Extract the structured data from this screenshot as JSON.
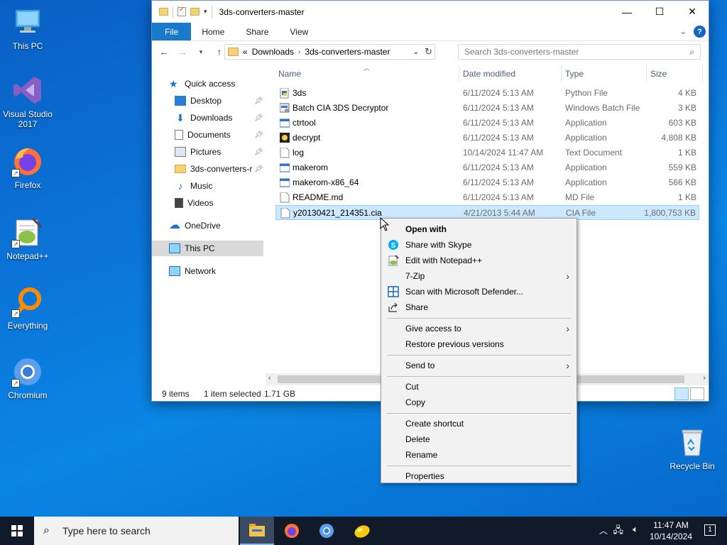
{
  "desktop": {
    "icons": [
      {
        "label": "This PC"
      },
      {
        "label": "Visual Studio 2017"
      },
      {
        "label": "Firefox"
      },
      {
        "label": "Notepad++"
      },
      {
        "label": "Everything"
      },
      {
        "label": "Chromium"
      },
      {
        "label": "Recycle Bin"
      }
    ]
  },
  "window": {
    "title": "3ds-converters-master",
    "tabs": [
      "File",
      "Home",
      "Share",
      "View"
    ],
    "address": {
      "prefix": "«",
      "crumbs": [
        "Downloads",
        "3ds-converters-master"
      ]
    },
    "search_placeholder": "Search 3ds-converters-master",
    "nav_pane": [
      {
        "label": "Quick access"
      },
      {
        "label": "Desktop"
      },
      {
        "label": "Downloads"
      },
      {
        "label": "Documents"
      },
      {
        "label": "Pictures"
      },
      {
        "label": "3ds-converters-r"
      },
      {
        "label": "Music"
      },
      {
        "label": "Videos"
      },
      {
        "label": "OneDrive"
      },
      {
        "label": "This PC"
      },
      {
        "label": "Network"
      }
    ],
    "columns": [
      "Name",
      "Date modified",
      "Type",
      "Size"
    ],
    "files": [
      {
        "name": "3ds",
        "date": "6/11/2024 5:13 AM",
        "type": "Python File",
        "size": "4 KB",
        "icon": "python-file-icon"
      },
      {
        "name": "Batch CIA 3DS Decryptor",
        "date": "6/11/2024 5:13 AM",
        "type": "Windows Batch File",
        "size": "3 KB",
        "icon": "batch-file-icon"
      },
      {
        "name": "ctrtool",
        "date": "6/11/2024 5:13 AM",
        "type": "Application",
        "size": "603 KB",
        "icon": "application-icon"
      },
      {
        "name": "decrypt",
        "date": "6/11/2024 5:13 AM",
        "type": "Application",
        "size": "4,808 KB",
        "icon": "decrypt-app-icon"
      },
      {
        "name": "log",
        "date": "10/14/2024 11:47 AM",
        "type": "Text Document",
        "size": "1 KB",
        "icon": "text-file-icon"
      },
      {
        "name": "makerom",
        "date": "6/11/2024 5:13 AM",
        "type": "Application",
        "size": "559 KB",
        "icon": "application-icon"
      },
      {
        "name": "makerom-x86_64",
        "date": "6/11/2024 5:13 AM",
        "type": "Application",
        "size": "566 KB",
        "icon": "application-icon"
      },
      {
        "name": "README.md",
        "date": "6/11/2024 5:13 AM",
        "type": "MD File",
        "size": "1 KB",
        "icon": "text-file-icon"
      },
      {
        "name": "y20130421_214351.cia",
        "date": "4/21/2013 5:44 AM",
        "type": "CIA File",
        "size": "1,800,753 KB",
        "icon": "blank-file-icon",
        "selected": true
      }
    ],
    "status": {
      "items": "9 items",
      "selected": "1 item selected",
      "size": "1.71 GB"
    }
  },
  "context_menu": {
    "groups": [
      [
        {
          "label": "Open with",
          "bold": true
        },
        {
          "label": "Share with Skype",
          "icon": "skype-icon"
        },
        {
          "label": "Edit with Notepad++",
          "icon": "notepadpp-icon"
        },
        {
          "label": "7-Zip",
          "submenu": true
        },
        {
          "label": "Scan with Microsoft Defender...",
          "icon": "defender-icon"
        },
        {
          "label": "Share",
          "icon": "share-icon"
        }
      ],
      [
        {
          "label": "Give access to",
          "submenu": true
        },
        {
          "label": "Restore previous versions"
        }
      ],
      [
        {
          "label": "Send to",
          "submenu": true
        }
      ],
      [
        {
          "label": "Cut"
        },
        {
          "label": "Copy"
        }
      ],
      [
        {
          "label": "Create shortcut"
        },
        {
          "label": "Delete"
        },
        {
          "label": "Rename"
        }
      ],
      [
        {
          "label": "Properties"
        }
      ]
    ]
  },
  "taskbar": {
    "search_placeholder": "Type here to search",
    "time": "11:47 AM",
    "date": "10/14/2024",
    "notification_count": "1"
  }
}
